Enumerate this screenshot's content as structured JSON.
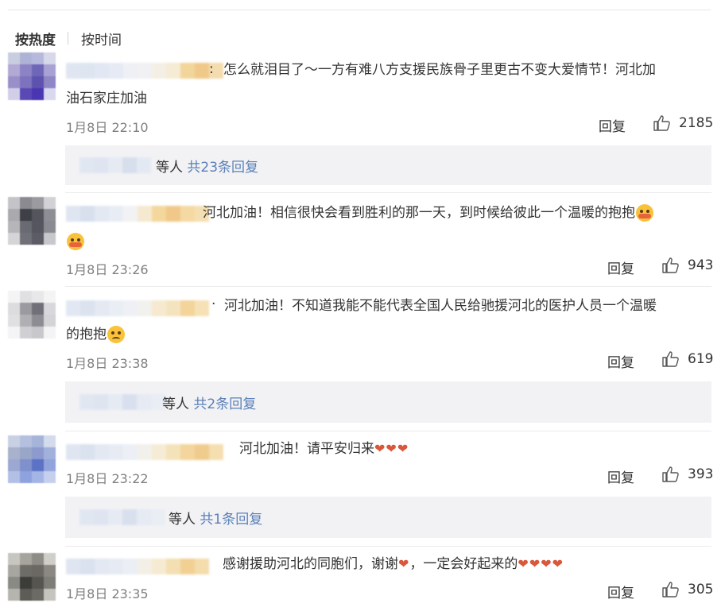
{
  "sort": {
    "hot_label": "按热度",
    "time_label": "按时间"
  },
  "comments": [
    {
      "colon": ":",
      "text": "怎么就泪目了～一方有难八方支援民族骨子里更古不变大爱情节！河北加",
      "text_cont": "油石家庄加油",
      "time": "1月8日 22:10",
      "reply_label": "回复",
      "likes": "2185",
      "sub": {
        "suffix": "等人",
        "link": "共23条回复"
      }
    },
    {
      "colon": "",
      "text": "河北加油！相信很快会看到胜利的那一天，到时候给彼此一个温暖的抱抱",
      "text_cont": "",
      "time": "1月8日 23:26",
      "reply_label": "回复",
      "likes": "943"
    },
    {
      "colon": "·",
      "text": "河北加油！不知道我能不能代表全国人民给驰援河北的医护人员一个温暖",
      "text_cont": "的抱抱",
      "time": "1月8日 23:38",
      "reply_label": "回复",
      "likes": "619",
      "sub": {
        "suffix": "等人",
        "link": "共2条回复"
      }
    },
    {
      "colon": "",
      "text": "河北加油！请平安归来",
      "text_cont": "",
      "time": "1月8日 23:22",
      "reply_label": "回复",
      "likes": "393",
      "sub": {
        "suffix": "等人",
        "link": "共1条回复"
      }
    },
    {
      "colon": "",
      "text": "感谢援助河北的同胞们，谢谢",
      "text_mid": "，一定会好起来的",
      "text_cont": "",
      "time": "1月8日 23:35",
      "reply_label": "回复",
      "likes": "305"
    }
  ],
  "icons": {
    "like": "thumbs-up-icon",
    "heart": "heart-emoji",
    "hug": "hug-emoji",
    "sad": "pleading-face-emoji"
  },
  "colors": {
    "link": "#5a80b8",
    "meta": "#808080",
    "subreply_bg": "#f2f2f5",
    "heart": "#d9573a"
  }
}
